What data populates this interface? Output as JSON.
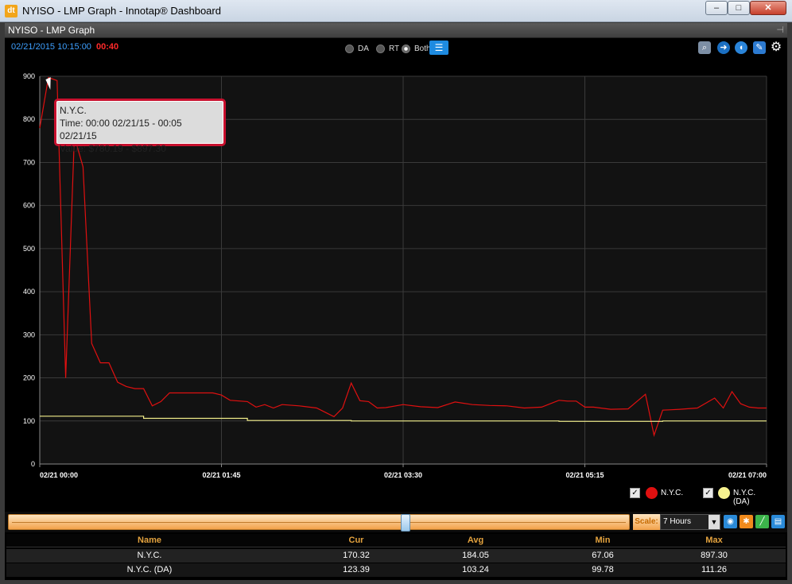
{
  "window": {
    "title": "NYISO - LMP Graph - Innotap® Dashboard",
    "min": "–",
    "max": "□",
    "close": "✕"
  },
  "panel": {
    "title": "NYISO - LMP Graph",
    "pin": "⊣"
  },
  "timestamp": {
    "date": "02/21/2015 10:15:00",
    "countdown": "00:40"
  },
  "mode": {
    "options": [
      "DA",
      "RT",
      "Both"
    ],
    "selected": "Both"
  },
  "toolbar_icons": [
    "zoom-icon",
    "arrow-right-icon",
    "sound-icon",
    "edit-icon",
    "gear-icon"
  ],
  "tooltip": {
    "title": "N.Y.C.",
    "time": "Time: 00:00 02/21/15 - 00:05 02/21/15",
    "value": "Value: $780.19 - $897.30"
  },
  "chart_data": {
    "type": "line",
    "ylim": [
      0,
      900
    ],
    "yticks": [
      0,
      100,
      200,
      300,
      400,
      500,
      600,
      700,
      800,
      900
    ],
    "xlim": [
      "2015-02-21 00:00",
      "2015-02-21 07:00"
    ],
    "xtick_labels": [
      "02/21 00:00",
      "02/21 01:45",
      "02/21 03:30",
      "02/21 05:15",
      "02/21 07:00"
    ],
    "grid": true,
    "colors": {
      "N.Y.C.": "#e01010",
      "N.Y.C.(DA)": "#f2ee8a"
    },
    "series": [
      {
        "name": "N.Y.C.",
        "x": [
          "00:00",
          "00:05",
          "00:10",
          "00:15",
          "00:20",
          "00:25",
          "00:30",
          "00:35",
          "00:40",
          "00:45",
          "00:50",
          "00:55",
          "01:00",
          "01:05",
          "01:10",
          "01:15",
          "01:20",
          "01:30",
          "01:40",
          "01:45",
          "01:50",
          "02:00",
          "02:05",
          "02:10",
          "02:15",
          "02:20",
          "02:30",
          "02:40",
          "02:45",
          "02:50",
          "02:55",
          "03:00",
          "03:05",
          "03:10",
          "03:15",
          "03:20",
          "03:30",
          "03:40",
          "03:50",
          "04:00",
          "04:10",
          "04:20",
          "04:30",
          "04:40",
          "04:50",
          "05:00",
          "05:05",
          "05:10",
          "05:15",
          "05:20",
          "05:30",
          "05:40",
          "05:50",
          "05:55",
          "06:00",
          "06:05",
          "06:10",
          "06:20",
          "06:30",
          "06:35",
          "06:40",
          "06:45",
          "06:50",
          "06:55",
          "07:00"
        ],
        "y": [
          780,
          897,
          890,
          200,
          760,
          690,
          280,
          235,
          235,
          190,
          180,
          175,
          175,
          135,
          145,
          165,
          165,
          165,
          165,
          160,
          148,
          145,
          132,
          138,
          130,
          138,
          135,
          130,
          120,
          110,
          130,
          188,
          147,
          145,
          130,
          131,
          138,
          133,
          131,
          144,
          138,
          136,
          135,
          130,
          132,
          148,
          146,
          146,
          132,
          132,
          127,
          128,
          162,
          67,
          125,
          126,
          127,
          130,
          153,
          130,
          168,
          140,
          132,
          130,
          130
        ]
      },
      {
        "name": "N.Y.C.(DA)",
        "x": [
          "00:00",
          "01:00",
          "01:00",
          "02:00",
          "02:00",
          "03:00",
          "03:00",
          "04:00",
          "04:00",
          "05:00",
          "05:00",
          "06:00",
          "06:00",
          "07:00"
        ],
        "y": [
          111,
          111,
          106,
          106,
          101,
          101,
          100,
          100,
          100,
          100,
          99,
          99,
          100,
          100
        ]
      }
    ]
  },
  "legend": {
    "items": [
      {
        "label": "N.Y.C.",
        "checked": "✓"
      },
      {
        "label": "N.Y.C.(DA)",
        "checked": "✓"
      }
    ]
  },
  "scale": {
    "label": "Scale:",
    "value": "7 Hours",
    "arrow": "▼"
  },
  "stats": {
    "headers": [
      "Name",
      "Cur",
      "Avg",
      "Min",
      "Max"
    ],
    "rows": [
      [
        "N.Y.C.",
        "170.32",
        "184.05",
        "67.06",
        "897.30"
      ],
      [
        "N.Y.C. (DA)",
        "123.39",
        "103.24",
        "99.78",
        "111.26"
      ]
    ]
  }
}
